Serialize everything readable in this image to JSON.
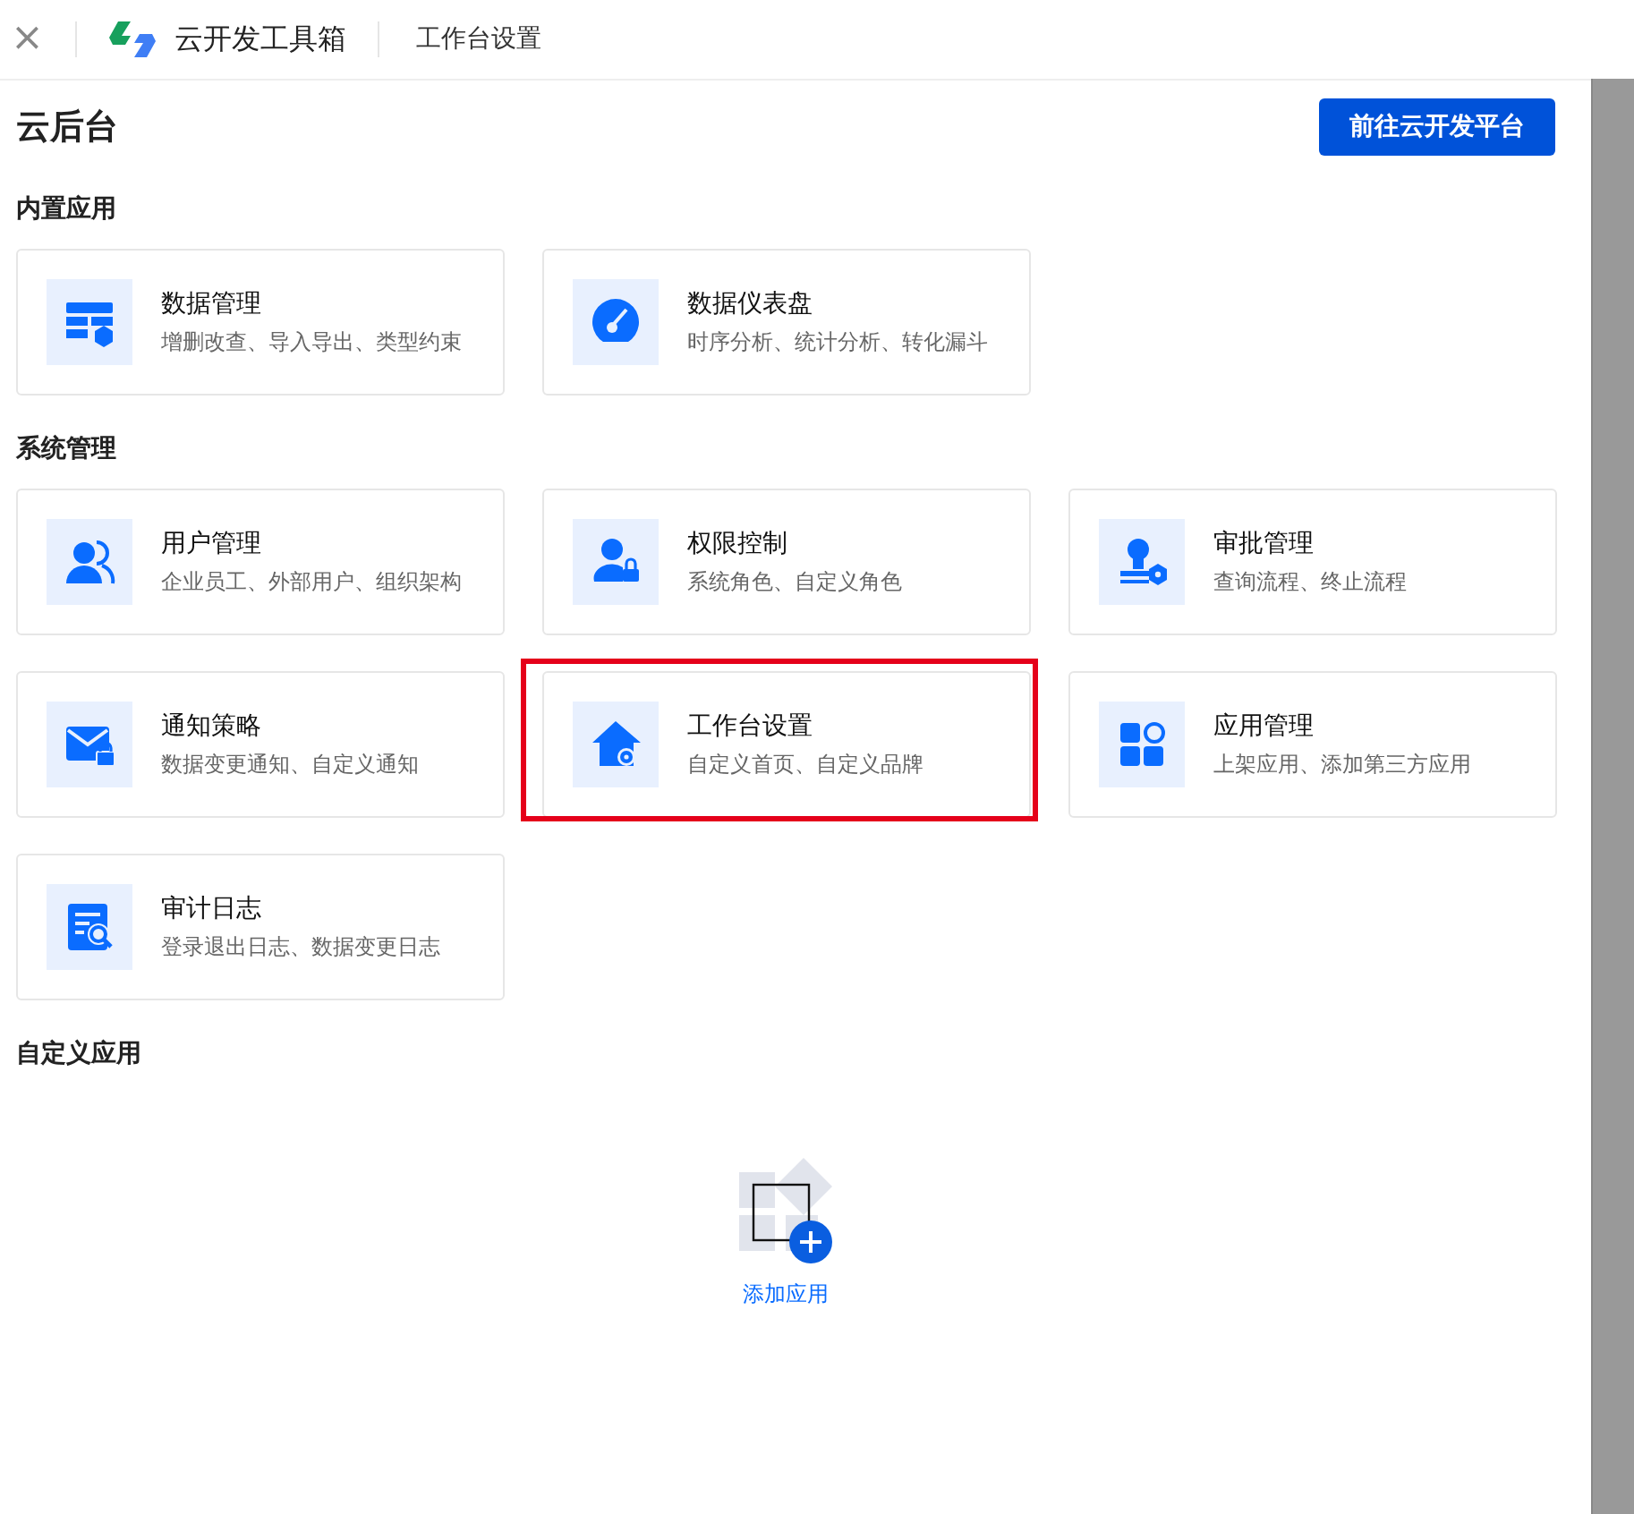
{
  "header": {
    "close": "×",
    "app_name": "云开发工具箱",
    "page_title": "工作台设置"
  },
  "title": "云后台",
  "action_button": "前往云开发平台",
  "sections": [
    {
      "title": "内置应用",
      "cards": [
        {
          "title": "数据管理",
          "desc": "增删改查、导入导出、类型约束",
          "highlighted": false
        },
        {
          "title": "数据仪表盘",
          "desc": "时序分析、统计分析、转化漏斗",
          "highlighted": false
        }
      ]
    },
    {
      "title": "系统管理",
      "cards": [
        {
          "title": "用户管理",
          "desc": "企业员工、外部用户、组织架构",
          "highlighted": false
        },
        {
          "title": "权限控制",
          "desc": "系统角色、自定义角色",
          "highlighted": false
        },
        {
          "title": "审批管理",
          "desc": "查询流程、终止流程",
          "highlighted": false
        },
        {
          "title": "通知策略",
          "desc": "数据变更通知、自定义通知",
          "highlighted": false
        },
        {
          "title": "工作台设置",
          "desc": "自定义首页、自定义品牌",
          "highlighted": true
        },
        {
          "title": "应用管理",
          "desc": "上架应用、添加第三方应用",
          "highlighted": false
        },
        {
          "title": "审计日志",
          "desc": "登录退出日志、数据变更日志",
          "highlighted": false
        }
      ]
    },
    {
      "title": "自定义应用",
      "empty_action": "添加应用"
    }
  ]
}
